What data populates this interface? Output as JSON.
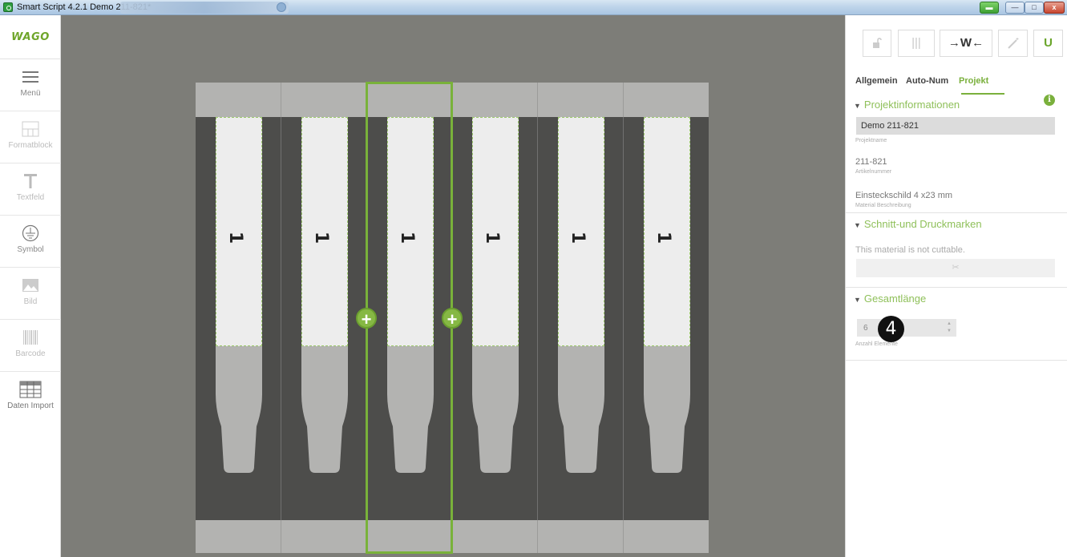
{
  "window": {
    "title": "Smart Script 4.2.1  Demo 211-821*",
    "buttons": {
      "tray": "▬",
      "minimize": "—",
      "maximize": "□",
      "close": "x"
    }
  },
  "logo": "WAGO",
  "sidebar": {
    "items": [
      {
        "label": "Menü",
        "icon": "menu-icon",
        "enabled": true
      },
      {
        "label": "Formatblock",
        "icon": "format-block-icon",
        "enabled": false
      },
      {
        "label": "Textfeld",
        "icon": "text-field-icon",
        "enabled": false
      },
      {
        "label": "Symbol",
        "icon": "ground-symbol-icon",
        "enabled": true
      },
      {
        "label": "Bild",
        "icon": "image-icon",
        "enabled": false
      },
      {
        "label": "Barcode",
        "icon": "barcode-icon",
        "enabled": false
      },
      {
        "label": "Daten Import",
        "icon": "table-import-icon",
        "enabled": true
      }
    ]
  },
  "canvas": {
    "labels": [
      "1",
      "1",
      "1",
      "1",
      "1",
      "1"
    ],
    "selected_index": 2,
    "colors": {
      "accent": "#79b23a",
      "strip": "#4d4d4b",
      "band": "#b3b3b1"
    }
  },
  "panel": {
    "toolbar": {
      "lock": "lock-icon",
      "bars": "|||",
      "fit": "→W←",
      "wand": "magic-wand-icon",
      "magnet": "U"
    },
    "tabs": [
      "Allgemein",
      "Auto-Num",
      "Projekt"
    ],
    "active_tab": "Projekt",
    "sections": {
      "project_info": {
        "title": "Projektinformationen",
        "name_value": "Demo 211-821",
        "name_label": "Projektname",
        "article_value": "211-821",
        "article_label": "Artikelnummer",
        "material_value": "Einsteckschild  4 x23 mm",
        "material_label": "Material Beschreibung"
      },
      "cut": {
        "title": "Schnitt-und Druckmarken",
        "message": "This material is not cuttable.",
        "button_icon": "✂"
      },
      "length": {
        "title": "Gesamtlänge",
        "count_value": "6",
        "count_label": "Anzahl Elemente"
      }
    },
    "callout": "4"
  }
}
